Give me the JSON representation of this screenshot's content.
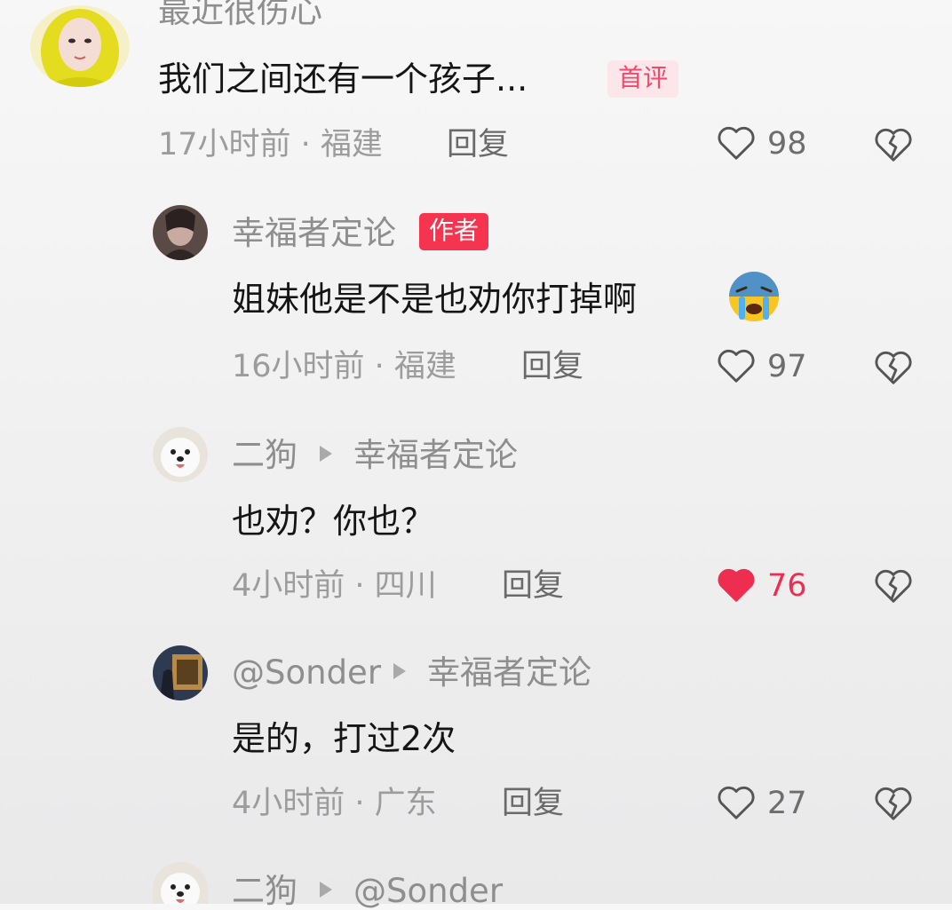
{
  "comments": [
    {
      "username": "最近很伤心",
      "content": "我们之间还有一个孩子...",
      "badge": "首评",
      "time": "17小时前 · 福建",
      "reply": "回复",
      "likes": "98",
      "liked": false
    },
    {
      "username": "幸福者定论",
      "badge": "作者",
      "content": "姐妹他是不是也劝你打掉啊",
      "emoji": "crying-face-emoji",
      "time": "16小时前 · 福建",
      "reply": "回复",
      "likes": "97",
      "liked": false
    },
    {
      "username": "二狗",
      "reply_to": "幸福者定论",
      "content": "也劝？你也？",
      "time": "4小时前 · 四川",
      "reply": "回复",
      "likes": "76",
      "liked": true
    },
    {
      "username": "@Sonder",
      "reply_to": "幸福者定论",
      "content": "是的，打过2次",
      "time": "4小时前 · 广东",
      "reply": "回复",
      "likes": "27",
      "liked": false
    },
    {
      "username": "二狗",
      "reply_to": "@Sonder"
    }
  ],
  "icons": {
    "like": "heart-outline-icon",
    "liked": "heart-filled-icon",
    "dislike": "broken-heart-icon",
    "reply_arrow": "triangle-right-icon"
  },
  "colors": {
    "liked": "#ee2e50",
    "author_badge": "#f5344f",
    "first_badge_bg": "#fde6ea",
    "first_badge_text": "#f04a6c"
  }
}
